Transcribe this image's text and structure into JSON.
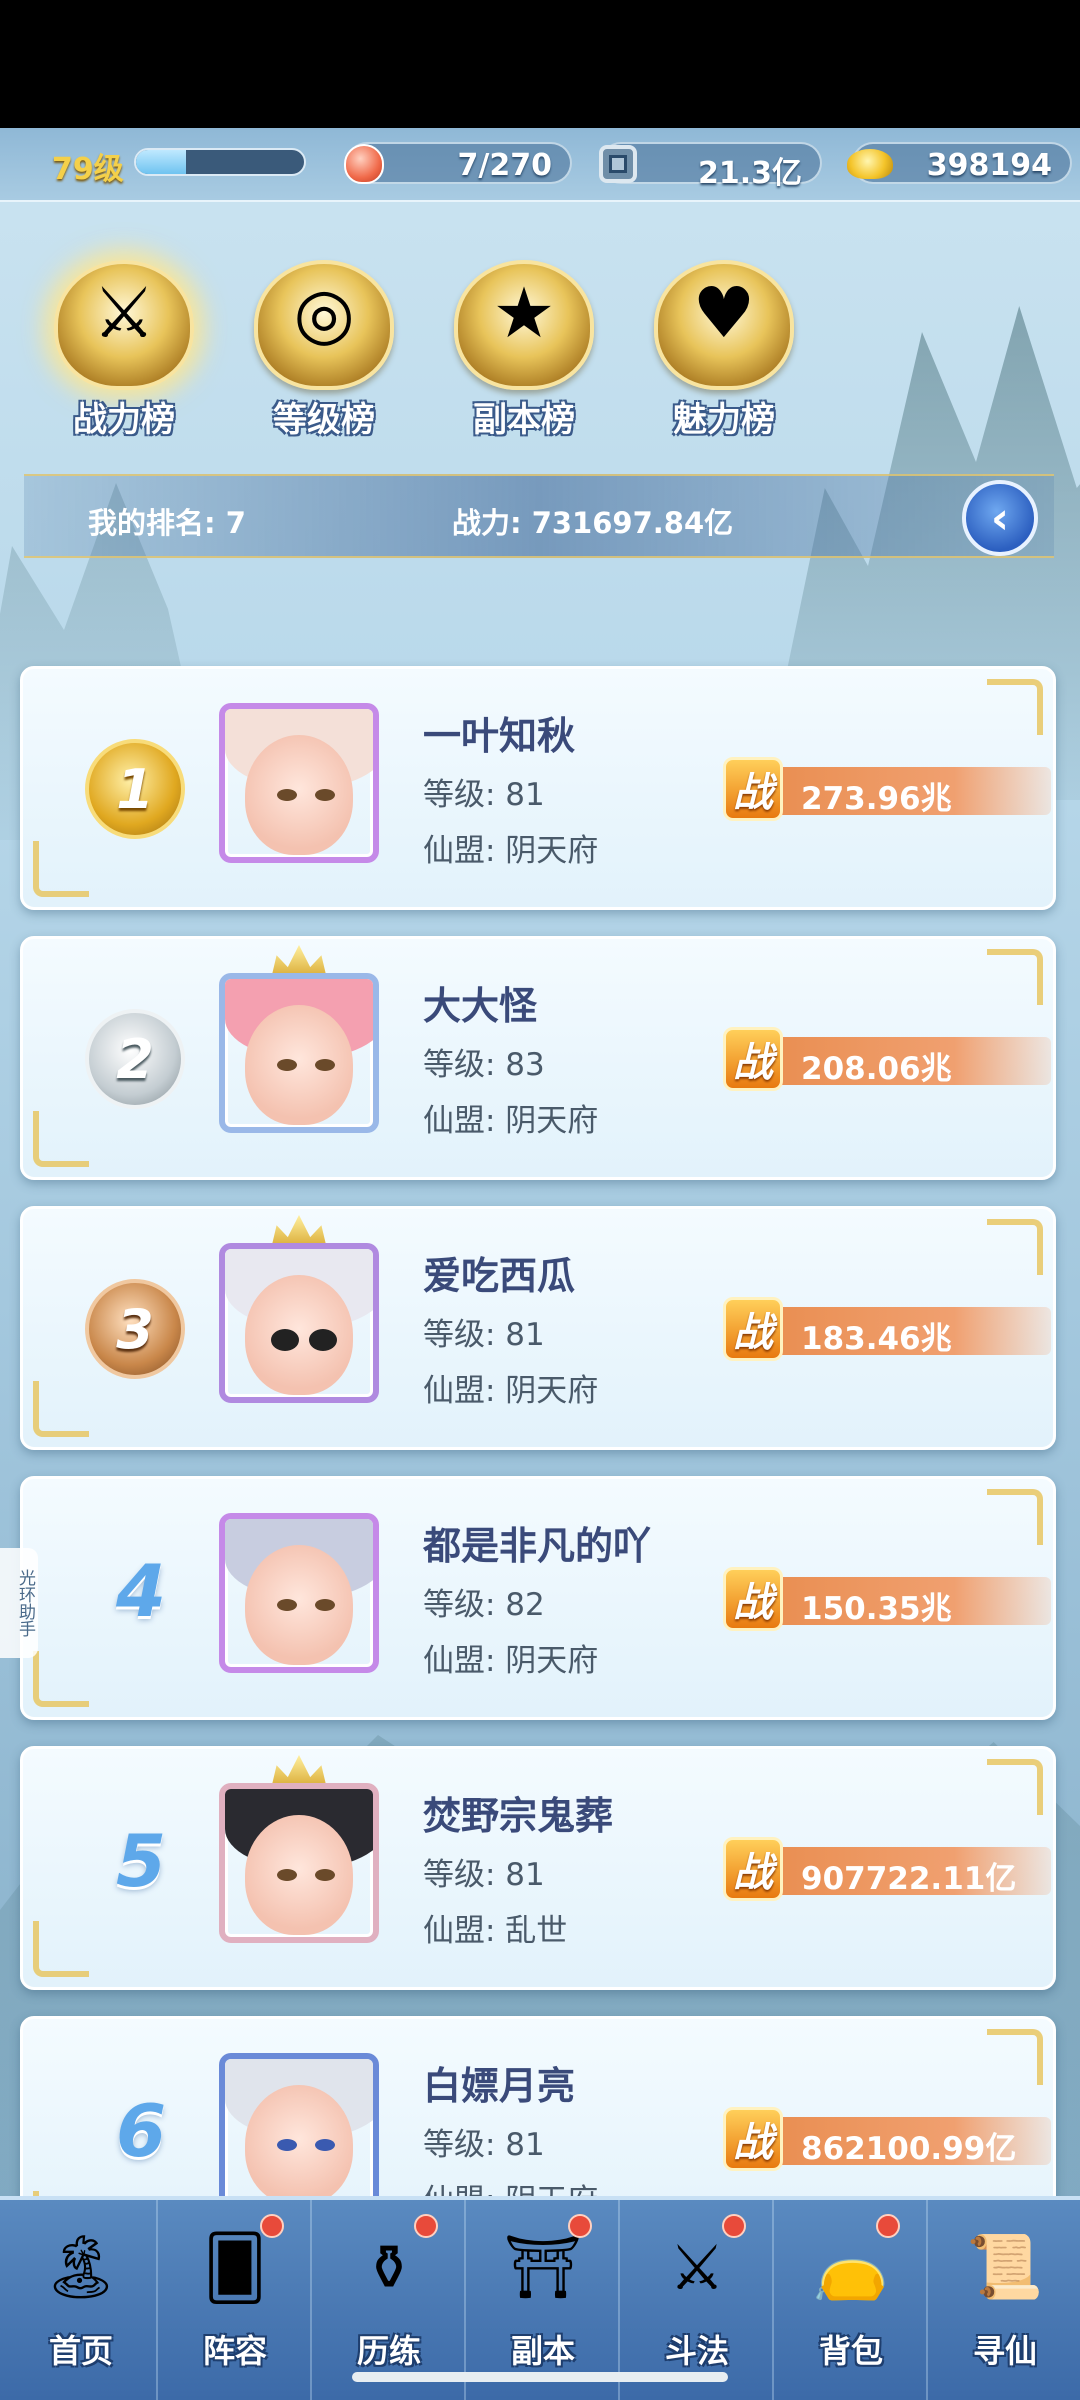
{
  "topbar": {
    "level": "79级",
    "xp_fraction": 0.3,
    "stamina": "7/270",
    "silver": "21.3亿",
    "gold": "398194",
    "icons": [
      "peach-icon",
      "coin-icon",
      "gold-ingot-icon"
    ]
  },
  "tabs": [
    {
      "label": "战力榜",
      "icon": "sword-emblem-icon",
      "active": true
    },
    {
      "label": "等级榜",
      "icon": "gong-emblem-icon",
      "active": false
    },
    {
      "label": "副本榜",
      "icon": "star-emblem-icon",
      "active": false
    },
    {
      "label": "魅力榜",
      "icon": "heart-emblem-icon",
      "active": false
    }
  ],
  "myrank": {
    "rank_text": "我的排名: 7",
    "power_text": "战力: 731697.84亿"
  },
  "rankings": [
    {
      "rank": "1",
      "name": "一叶知秋",
      "level": "等级: 81",
      "guild": "仙盟: 阴天府",
      "power": "273.96兆",
      "power_icon": "战"
    },
    {
      "rank": "2",
      "name": "大大怪",
      "level": "等级: 83",
      "guild": "仙盟: 阴天府",
      "power": "208.06兆",
      "power_icon": "战"
    },
    {
      "rank": "3",
      "name": "爱吃西瓜",
      "level": "等级: 81",
      "guild": "仙盟: 阴天府",
      "power": "183.46兆",
      "power_icon": "战"
    },
    {
      "rank": "4",
      "name": "都是非凡的吖",
      "level": "等级: 82",
      "guild": "仙盟: 阴天府",
      "power": "150.35兆",
      "power_icon": "战"
    },
    {
      "rank": "5",
      "name": "焚野宗鬼葬",
      "level": "等级: 81",
      "guild": "仙盟: 乱世",
      "power": "907722.11亿",
      "power_icon": "战"
    },
    {
      "rank": "6",
      "name": "白嫖月亮",
      "level": "等级: 81",
      "guild": "仙盟: 阴天府",
      "power": "862100.99亿",
      "power_icon": "战"
    }
  ],
  "helper": "光环助手",
  "bottomnav": [
    {
      "label": "首页",
      "icon": "home-island-icon",
      "badge": false
    },
    {
      "label": "阵容",
      "icon": "cards-icon",
      "badge": true
    },
    {
      "label": "历练",
      "icon": "gourd-icon",
      "badge": true
    },
    {
      "label": "副本",
      "icon": "gate-icon",
      "badge": true
    },
    {
      "label": "斗法",
      "icon": "crossed-swords-icon",
      "badge": true
    },
    {
      "label": "背包",
      "icon": "bag-icon",
      "badge": true
    },
    {
      "label": "寻仙",
      "icon": "scroll-icon",
      "badge": false
    }
  ],
  "colors": {
    "accent_gold": "#e8c45a",
    "power_orange": "#e88a4a",
    "name_color": "#3a4a7a",
    "nav_blue": "#3c6aa8"
  }
}
